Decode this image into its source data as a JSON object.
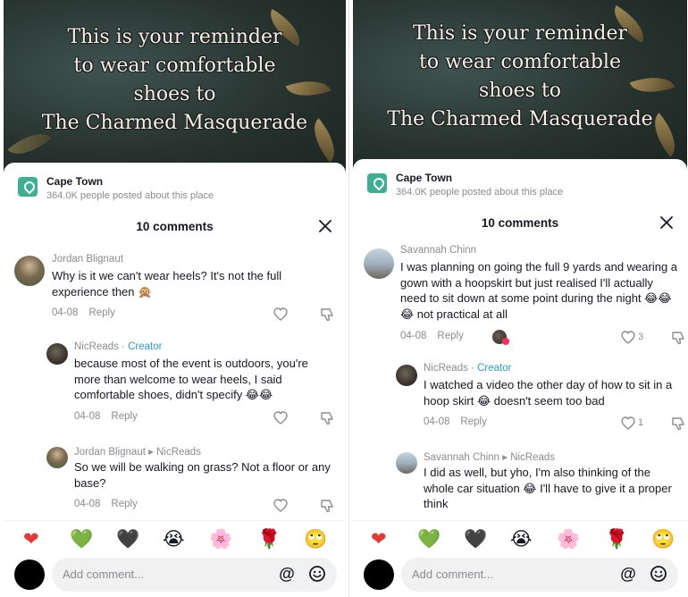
{
  "overlay_lines": [
    "This is your reminder",
    "to wear comfortable",
    "shoes to",
    "The Charmed Masquerade"
  ],
  "location": {
    "name": "Cape Town",
    "subtitle": "364.0K people posted about this place"
  },
  "header": {
    "title": "10 comments"
  },
  "input": {
    "placeholder": "Add comment..."
  },
  "emojis": [
    "❤",
    "💚",
    "🖤",
    "😭",
    "🌸",
    "🌹",
    "🙄"
  ],
  "colors": {
    "accent": "#fe2c55",
    "creator": "#2a9dc8",
    "location_icon": "#3fb08f"
  },
  "left": {
    "comments": [
      {
        "author": "Jordan Blignaut",
        "text": "Why is it we can't wear heels? It's not the full experience then 🙊",
        "date": "04-08",
        "reply": "Reply"
      },
      {
        "author": "NicReads",
        "author_tag": " · Creator",
        "text": "because most of the event is outdoors, you're more than welcome to wear heels, I said comfortable shoes, didn't specify 😂😂",
        "date": "04-08",
        "reply": "Reply"
      },
      {
        "author": "Jordan Blignaut ▸ NicReads",
        "text": "So we will be walking on grass? Not a floor or any base?",
        "date": "04-08",
        "reply": "Reply"
      }
    ]
  },
  "right": {
    "comments": [
      {
        "author": "Savannah Chinn",
        "text": "I was planning on going the full 9 yards and wearing a gown with a hoopskirt but just realised I'll actually need to sit down at some point during the night 😂😂😂 not practical at all",
        "date": "04-08",
        "reply": "Reply",
        "likes": "3"
      },
      {
        "author": "NicReads",
        "author_tag": " · Creator",
        "text": "I watched a video the other day of how to sit in a hoop skirt 😂 doesn't seem too bad",
        "date": "04-08",
        "reply": "Reply",
        "likes": "1"
      },
      {
        "author": "Savannah Chinn ▸ NicReads",
        "text": "I did as well, but yho, I'm also thinking of the whole car situation 😂 I'll have to give it a proper think"
      }
    ]
  }
}
